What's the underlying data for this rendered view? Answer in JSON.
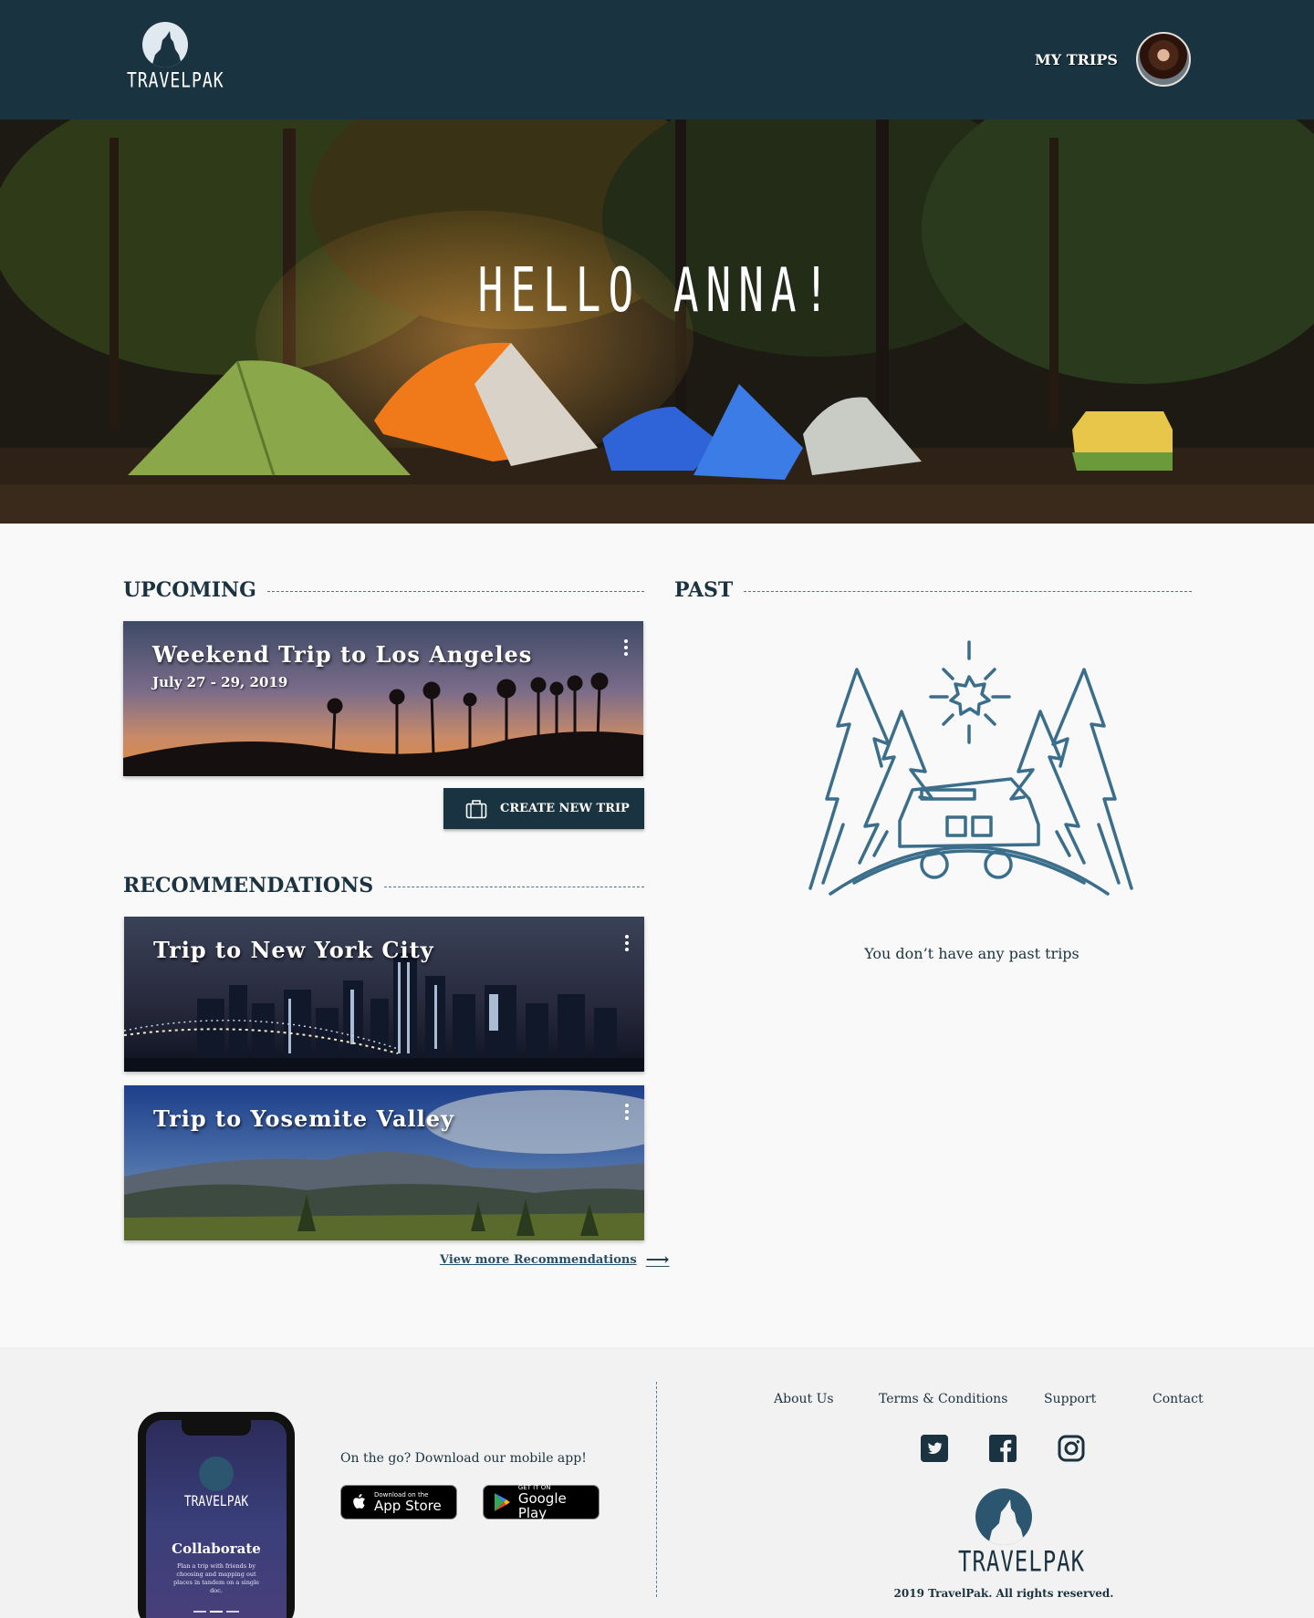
{
  "header": {
    "logo_text": "TRAVELPAK",
    "nav_my_trips": "MY TRIPS"
  },
  "hero": {
    "greeting": "HELLO ANNA!"
  },
  "upcoming": {
    "heading": "UPCOMING",
    "trips": [
      {
        "title": "Weekend Trip to Los Angeles",
        "dates": "July 27 - 29, 2019"
      }
    ],
    "create_button": "CREATE NEW TRIP"
  },
  "recommendations": {
    "heading": "RECOMMENDATIONS",
    "trips": [
      {
        "title": "Trip to New York City"
      },
      {
        "title": "Trip to Yosemite Valley"
      }
    ],
    "view_more": "View more Recommendations"
  },
  "past": {
    "heading": "PAST",
    "empty_message": "You don’t have any past trips"
  },
  "footer": {
    "phone": {
      "logo_text": "TRAVELPAK",
      "headline": "Collaborate",
      "description": "Plan a trip with friends by choosing and mapping out places in tandem on a single doc."
    },
    "app_prompt": "On the go? Download our mobile app!",
    "app_store": {
      "small": "Download on the",
      "big": "App Store"
    },
    "google_play": {
      "small": "GET IT ON",
      "big": "Google Play"
    },
    "links": [
      "About Us",
      "Terms & Conditions",
      "Support",
      "Contact"
    ],
    "social_icons": [
      "twitter-icon",
      "facebook-icon",
      "instagram-icon"
    ],
    "logo_text": "TRAVELPAK",
    "copyright": "2019 TravelPak. All rights reserved."
  },
  "colors": {
    "navy": "#193440",
    "accent_blue": "#3b6e8a",
    "background": "#f9f9f9",
    "footer_background": "#f2f2f2"
  }
}
